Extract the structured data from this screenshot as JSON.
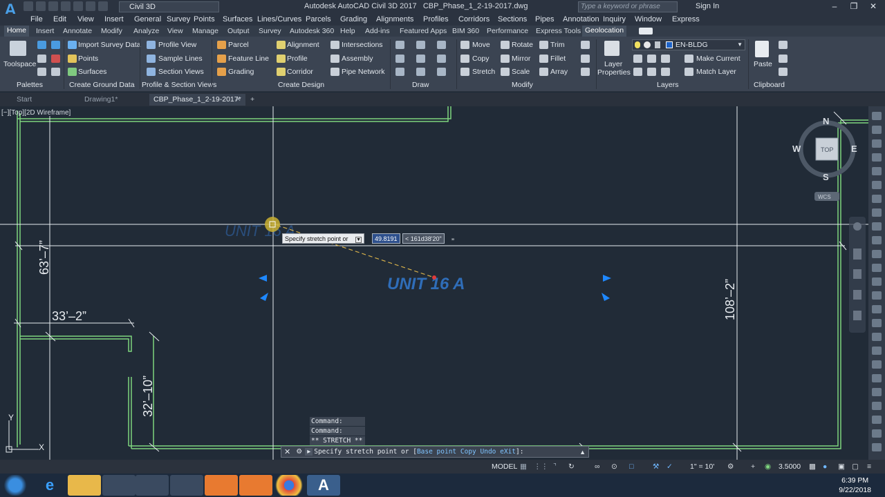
{
  "title_bar": {
    "app_title": "Autodesk AutoCAD Civil 3D 2017",
    "file_name": "CBP_Phase_1_2-19-2017.dwg",
    "workspace": "Civil 3D",
    "search_placeholder": "Type a keyword or phrase",
    "sign_in": "Sign In"
  },
  "menu": [
    "File",
    "Edit",
    "View",
    "Insert",
    "General",
    "Survey",
    "Points",
    "Surfaces",
    "Lines/Curves",
    "Parcels",
    "Grading",
    "Alignments",
    "Profiles",
    "Corridors",
    "Sections",
    "Pipes",
    "Annotation",
    "Inquiry",
    "Window",
    "Express"
  ],
  "ribbon_tabs": [
    "Home",
    "Insert",
    "Annotate",
    "Modify",
    "Analyze",
    "View",
    "Manage",
    "Output",
    "Survey",
    "Autodesk 360",
    "Help",
    "Add-ins",
    "Featured Apps",
    "BIM 360",
    "Performance",
    "Express Tools",
    "Geolocation"
  ],
  "ribbon": {
    "toolspace": "Toolspace",
    "import_survey": "Import Survey Data",
    "points": "Points",
    "surfaces": "Surfaces",
    "profile_view": "Profile View",
    "sample_lines": "Sample Lines",
    "section_views": "Section Views",
    "parcel": "Parcel",
    "feature_line": "Feature Line",
    "grading": "Grading",
    "alignment": "Alignment",
    "profile": "Profile",
    "corridor": "Corridor",
    "intersections": "Intersections",
    "assembly": "Assembly",
    "pipe_network": "Pipe Network",
    "move": "Move",
    "copy": "Copy",
    "stretch": "Stretch",
    "rotate": "Rotate",
    "mirror": "Mirror",
    "scale": "Scale",
    "trim": "Trim",
    "fillet": "Fillet",
    "array": "Array",
    "layer_properties_1": "Layer",
    "layer_properties_2": "Properties",
    "current_layer": "EN-BLDG",
    "make_current": "Make Current",
    "match_layer": "Match Layer",
    "paste": "Paste",
    "panels": {
      "palettes": "Palettes",
      "create_ground_data": "Create Ground Data",
      "profile_section_views": "Profile & Section Views",
      "create_design": "Create Design",
      "draw": "Draw",
      "modify": "Modify",
      "layers": "Layers",
      "clipboard": "Clipboard"
    }
  },
  "file_tabs": [
    "Start",
    "Drawing1*",
    "CBP_Phase_1_2-19-2017*"
  ],
  "viewport": {
    "label": "[−][Top][2D Wireframe]",
    "viewcube": {
      "top": "TOP",
      "n": "N",
      "s": "S",
      "e": "E",
      "w": "W",
      "wcs": "WCS"
    },
    "unit_label": "UNIT  16  A",
    "ghost_label": "UNIT  16  A",
    "dim_63": "63’–7”",
    "dim_33": "33’–2”",
    "dim_32": "32’–10”",
    "dim_108": "108’–2”",
    "dim_quote": "”",
    "axis_y": "Y",
    "axis_x": "X"
  },
  "tooltip": {
    "prompt": "Specify stretch point or",
    "distance": "49.8191",
    "angle": "< 161d38'20\""
  },
  "command": {
    "history": [
      "Command:",
      "Command:",
      "** STRETCH **"
    ],
    "prompt_prefix": "Specify stretch point or [",
    "opt1": "Base point",
    "opt2": "Copy",
    "opt3": "Undo",
    "opt4": "eXit",
    "prompt_suffix": "]:"
  },
  "status": {
    "model": "MODEL",
    "scale": "1\" = 10'",
    "value": "3.5000"
  },
  "clock": {
    "time": "6:39 PM",
    "date": "9/22/2018"
  },
  "colors": {
    "lines": "#7fd67f",
    "white": "#e8ecf0",
    "unit_text": "#2f6db8",
    "grip": "#1e88ff"
  }
}
